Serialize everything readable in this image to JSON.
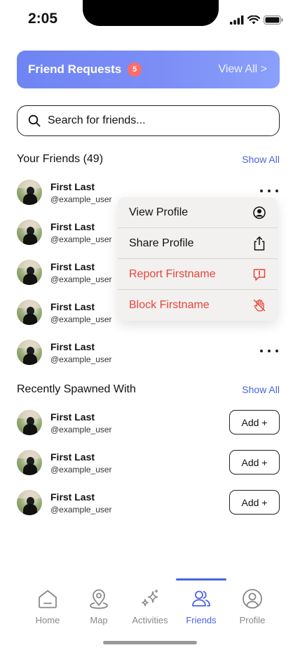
{
  "status": {
    "time": "2:05"
  },
  "banner": {
    "title": "Friend Requests",
    "count": "5",
    "link": "View All >"
  },
  "search": {
    "placeholder": "Search for friends..."
  },
  "friends_section": {
    "title": "Your Friends (49)",
    "show_all": "Show All",
    "items": [
      {
        "name": "First Last",
        "handle": "@example_user"
      },
      {
        "name": "First Last",
        "handle": "@example_user"
      },
      {
        "name": "First Last",
        "handle": "@example_user"
      },
      {
        "name": "First Last",
        "handle": "@example_user"
      },
      {
        "name": "First Last",
        "handle": "@example_user"
      }
    ]
  },
  "context_menu": {
    "items": [
      {
        "label": "View Profile",
        "icon": "user-circle-icon"
      },
      {
        "label": "Share Profile",
        "icon": "share-icon"
      },
      {
        "label": "Report Firstname",
        "icon": "report-icon",
        "danger": true
      },
      {
        "label": "Block Firstname",
        "icon": "block-hand-icon",
        "danger": true
      }
    ]
  },
  "recent_section": {
    "title": "Recently Spawned With",
    "show_all": "Show All",
    "add_label": "Add +",
    "items": [
      {
        "name": "First Last",
        "handle": "@example_user"
      },
      {
        "name": "First Last",
        "handle": "@example_user"
      },
      {
        "name": "First Last",
        "handle": "@example_user"
      }
    ]
  },
  "tabbar": {
    "tabs": [
      {
        "label": "Home",
        "icon": "home-icon"
      },
      {
        "label": "Map",
        "icon": "map-pin-icon"
      },
      {
        "label": "Activities",
        "icon": "sparkles-icon"
      },
      {
        "label": "Friends",
        "icon": "friends-icon",
        "active": true
      },
      {
        "label": "Profile",
        "icon": "profile-icon"
      }
    ]
  },
  "colors": {
    "accent": "#4a63e0",
    "banner": "#7c8ef6",
    "badge": "#ff6b6b",
    "danger": "#e5443b"
  }
}
